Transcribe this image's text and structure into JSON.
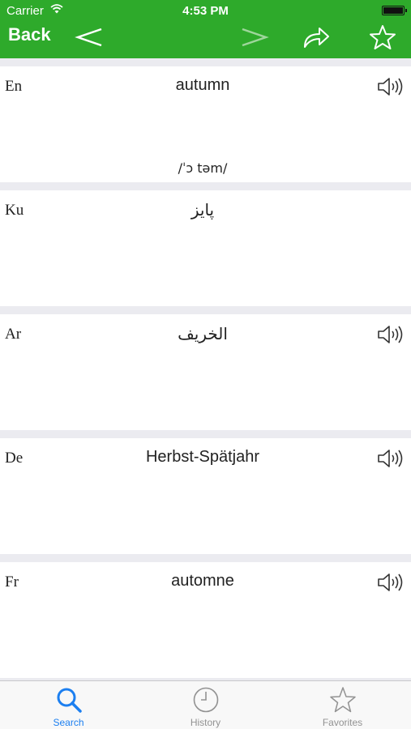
{
  "status_bar": {
    "carrier": "Carrier",
    "time": "4:53 PM"
  },
  "header": {
    "back_label": "Back",
    "icons": [
      "chevron-left-icon",
      "chevron-right-icon",
      "share-icon",
      "star-icon"
    ]
  },
  "entries": [
    {
      "lang": "En",
      "word": "autumn",
      "phonetic": "/ˈɔ təm/",
      "has_audio": true
    },
    {
      "lang": "Ku",
      "word": "پایز",
      "phonetic": "",
      "has_audio": false
    },
    {
      "lang": "Ar",
      "word": "الخريف",
      "phonetic": "",
      "has_audio": true
    },
    {
      "lang": "De",
      "word": "Herbst-Spätjahr",
      "phonetic": "",
      "has_audio": true
    },
    {
      "lang": "Fr",
      "word": "automne",
      "phonetic": "",
      "has_audio": true
    }
  ],
  "tabs": [
    {
      "label": "Search",
      "icon": "magnifier-icon",
      "active": true
    },
    {
      "label": "History",
      "icon": "clock-icon",
      "active": false
    },
    {
      "label": "Favorites",
      "icon": "star-icon",
      "active": false
    }
  ],
  "colors": {
    "header_bg": "#2eaa2b",
    "active_tab": "#1c7ff0",
    "inactive_tab": "#929292",
    "separator": "#ebebf0"
  }
}
